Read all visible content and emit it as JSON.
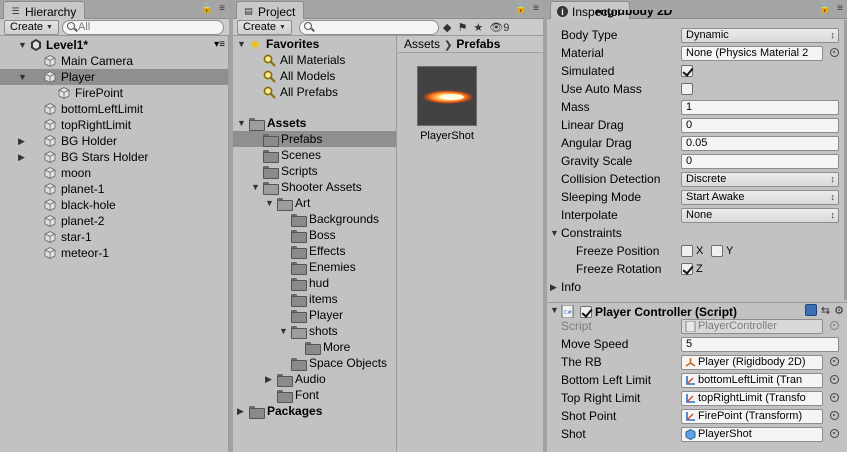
{
  "hierarchy": {
    "tab_label": "Hierarchy",
    "create_label": "Create",
    "search_placeholder": "All",
    "scene_name": "Level1*",
    "items": [
      {
        "label": "Main Camera",
        "depth": 1,
        "arrow": ""
      },
      {
        "label": "Player",
        "depth": 1,
        "arrow": "open",
        "selected": true
      },
      {
        "label": "FirePoint",
        "depth": 2,
        "arrow": ""
      },
      {
        "label": "bottomLeftLimit",
        "depth": 1,
        "arrow": ""
      },
      {
        "label": "topRightLimit",
        "depth": 1,
        "arrow": ""
      },
      {
        "label": "BG Holder",
        "depth": 1,
        "arrow": "closed"
      },
      {
        "label": "BG Stars Holder",
        "depth": 1,
        "arrow": "closed"
      },
      {
        "label": "moon",
        "depth": 1,
        "arrow": ""
      },
      {
        "label": "planet-1",
        "depth": 1,
        "arrow": ""
      },
      {
        "label": "black-hole",
        "depth": 1,
        "arrow": ""
      },
      {
        "label": "planet-2",
        "depth": 1,
        "arrow": ""
      },
      {
        "label": "star-1",
        "depth": 1,
        "arrow": ""
      },
      {
        "label": "meteor-1",
        "depth": 1,
        "arrow": ""
      }
    ]
  },
  "project": {
    "tab_label": "Project",
    "create_label": "Create",
    "hidden_count": "9",
    "favorites_label": "Favorites",
    "favorites": [
      "All Materials",
      "All Models",
      "All Prefabs"
    ],
    "assets_label": "Assets",
    "asset_tree": [
      {
        "label": "Prefabs",
        "depth": 1,
        "arrow": "",
        "selected": true
      },
      {
        "label": "Scenes",
        "depth": 1,
        "arrow": ""
      },
      {
        "label": "Scripts",
        "depth": 1,
        "arrow": ""
      },
      {
        "label": "Shooter Assets",
        "depth": 1,
        "arrow": "open"
      },
      {
        "label": "Art",
        "depth": 2,
        "arrow": "open"
      },
      {
        "label": "Backgrounds",
        "depth": 3,
        "arrow": ""
      },
      {
        "label": "Boss",
        "depth": 3,
        "arrow": ""
      },
      {
        "label": "Effects",
        "depth": 3,
        "arrow": ""
      },
      {
        "label": "Enemies",
        "depth": 3,
        "arrow": ""
      },
      {
        "label": "hud",
        "depth": 3,
        "arrow": ""
      },
      {
        "label": "items",
        "depth": 3,
        "arrow": ""
      },
      {
        "label": "Player",
        "depth": 3,
        "arrow": ""
      },
      {
        "label": "shots",
        "depth": 3,
        "arrow": "open"
      },
      {
        "label": "More",
        "depth": 4,
        "arrow": ""
      },
      {
        "label": "Space Objects",
        "depth": 3,
        "arrow": ""
      },
      {
        "label": "Audio",
        "depth": 2,
        "arrow": "closed"
      },
      {
        "label": "Font",
        "depth": 2,
        "arrow": ""
      }
    ],
    "packages_label": "Packages",
    "breadcrumb": [
      "Assets",
      "Prefabs"
    ],
    "asset_item": "PlayerShot"
  },
  "inspector": {
    "tab_label": "Inspector",
    "top_header": "Rigidbody 2D",
    "rigidbody": {
      "body_type_label": "Body Type",
      "body_type_value": "Dynamic",
      "material_label": "Material",
      "material_value": "None (Physics Material 2",
      "simulated_label": "Simulated",
      "simulated": true,
      "use_auto_mass_label": "Use Auto Mass",
      "use_auto_mass": false,
      "mass_label": "Mass",
      "mass_value": "1",
      "linear_drag_label": "Linear Drag",
      "linear_drag_value": "0",
      "angular_drag_label": "Angular Drag",
      "angular_drag_value": "0.05",
      "gravity_scale_label": "Gravity Scale",
      "gravity_scale_value": "0",
      "collision_detection_label": "Collision Detection",
      "collision_detection_value": "Discrete",
      "sleeping_mode_label": "Sleeping Mode",
      "sleeping_mode_value": "Start Awake",
      "interpolate_label": "Interpolate",
      "interpolate_value": "None",
      "constraints_label": "Constraints",
      "freeze_position_label": "Freeze Position",
      "freeze_rotation_label": "Freeze Rotation",
      "x_label": "X",
      "y_label": "Y",
      "z_label": "Z",
      "freeze_pos_x": false,
      "freeze_pos_y": false,
      "freeze_rot_z": true,
      "info_label": "Info"
    },
    "player_controller": {
      "header_label": "Player Controller (Script)",
      "enabled": true,
      "script_label": "Script",
      "script_value": "PlayerController",
      "move_speed_label": "Move Speed",
      "move_speed_value": "5",
      "the_rb_label": "The RB",
      "the_rb_value": "Player (Rigidbody 2D)",
      "bottom_left_label": "Bottom Left Limit",
      "bottom_left_value": "bottomLeftLimit (Tran",
      "top_right_label": "Top Right Limit",
      "top_right_value": "topRightLimit (Transfo",
      "shot_point_label": "Shot Point",
      "shot_point_value": "FirePoint (Transform)",
      "shot_label": "Shot",
      "shot_value": "PlayerShot"
    }
  },
  "colors": {
    "panel_bg": "#c2c2c2",
    "selection": "#8f8f8f",
    "tab_bar": "#a5a5a5"
  }
}
